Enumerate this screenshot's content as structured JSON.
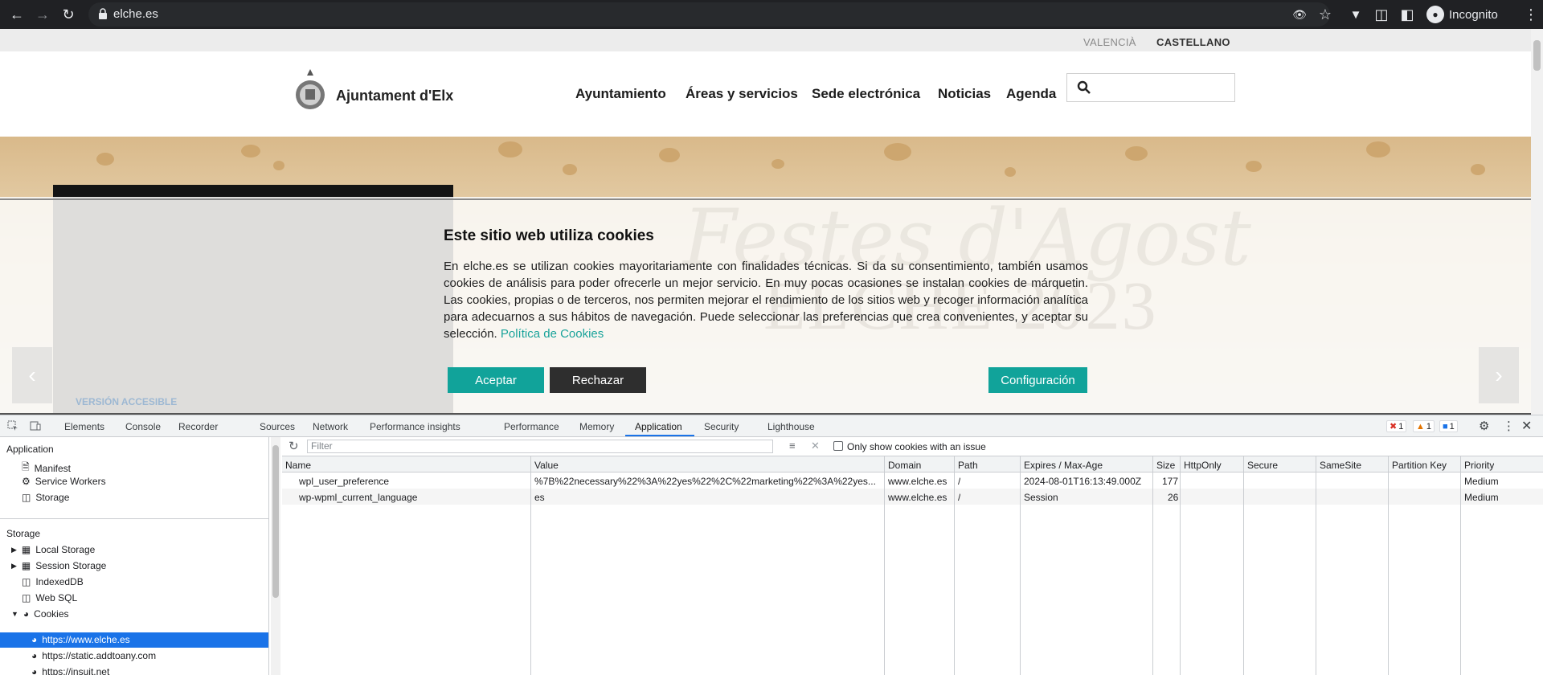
{
  "browser": {
    "url": "elche.es",
    "profile_label": "Incognito"
  },
  "site": {
    "lang": [
      "VALENCIÀ",
      "CASTELLANO"
    ],
    "logo_text": "Ajuntament d'Elx",
    "nav": [
      "Ayuntamiento",
      "Áreas y servicios",
      "Sede electrónica",
      "Noticias",
      "Agenda"
    ],
    "hero_ghost_big": "ELCHE 2023",
    "hero_ghost_script": "Festes d'Agost",
    "accessible_version": "VERSIÓN ACCESIBLE"
  },
  "cookie_banner": {
    "title": "Este sitio web utiliza cookies",
    "body": "En elche.es se utilizan cookies mayoritariamente con finalidades técnicas. Si da su consentimiento, también usamos cookies de análisis para poder ofrecerle un mejor servicio. En muy pocas ocasiones se instalan cookies de márquetin. Las cookies, propias o de terceros, nos permiten mejorar el rendimiento de los sitios web y recoger información analítica para adecuarnos a sus hábitos de navegación. Puede seleccionar las preferencias que crea convenientes, y aceptar su selección.",
    "link": "Política de Cookies",
    "accept": "Aceptar",
    "reject": "Rechazar",
    "config": "Configuración"
  },
  "devtools": {
    "tabs": [
      "Elements",
      "Console",
      "Recorder",
      "Sources",
      "Network",
      "Performance insights",
      "Performance",
      "Memory",
      "Application",
      "Security",
      "Lighthouse"
    ],
    "active_tab": "Application",
    "counts": {
      "errors": "1",
      "warnings": "1",
      "info": "1"
    },
    "sidebar": {
      "app_section": "Application",
      "app_items": [
        "Manifest",
        "Service Workers",
        "Storage"
      ],
      "storage_section": "Storage",
      "storage_items": [
        "Local Storage",
        "Session Storage",
        "IndexedDB",
        "Web SQL",
        "Cookies"
      ],
      "cookie_origins": [
        "https://www.elche.es",
        "https://static.addtoany.com",
        "https://insuit.net"
      ]
    },
    "filter_placeholder": "Filter",
    "only_issue_label": "Only show cookies with an issue",
    "columns": [
      "Name",
      "Value",
      "Domain",
      "Path",
      "Expires / Max-Age",
      "Size",
      "HttpOnly",
      "Secure",
      "SameSite",
      "Partition Key",
      "Priority"
    ],
    "rows": [
      [
        "wpl_user_preference",
        "%7B%22necessary%22%3A%22yes%22%2C%22marketing%22%3A%22yes...",
        "www.elche.es",
        "/",
        "2024-08-01T16:13:49.000Z",
        "177",
        "",
        "",
        "",
        "",
        "Medium"
      ],
      [
        "wp-wpml_current_language",
        "es",
        "www.elche.es",
        "/",
        "Session",
        "26",
        "",
        "",
        "",
        "",
        "Medium"
      ]
    ]
  }
}
